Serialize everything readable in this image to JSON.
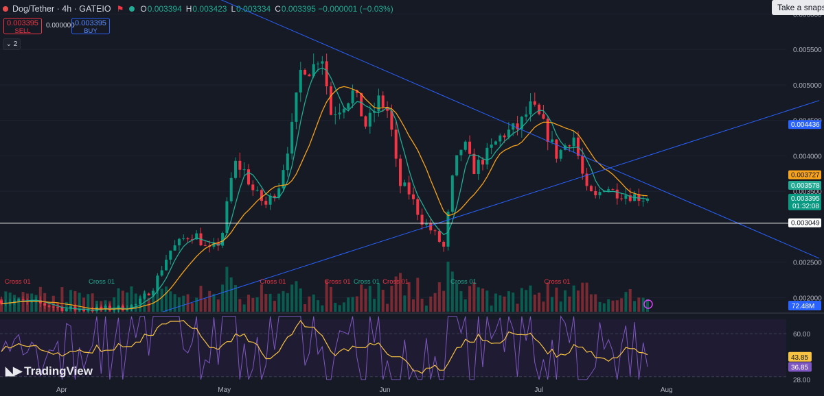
{
  "header": {
    "symbol": "Dog/Tether · 4h · GATEIO",
    "flag_icon": "flag-icon",
    "ohlc": [
      {
        "label": "O",
        "value": "0.003394"
      },
      {
        "label": "H",
        "value": "0.003423"
      },
      {
        "label": "L",
        "value": "0.003334"
      },
      {
        "label": "C",
        "value": "0.003395 −0.000001 (−0.03%)"
      }
    ]
  },
  "trade": {
    "sell_price": "0.003395",
    "sell_label": "SELL",
    "spread": "0.000000",
    "buy_price": "0.003395",
    "buy_label": "BUY"
  },
  "indicator_toggle": "2",
  "snapshot_tooltip": "Take a snapshot",
  "logo_text": "TradingView",
  "colors": {
    "background": "#161a25",
    "up": "#089981",
    "down": "#f23645",
    "ma_fast": "#22ab94",
    "ma_slow": "#f7a21b",
    "trendline": "#2962ff",
    "rsi": "#7e57c2",
    "rsi_ma": "#f7c343"
  },
  "chart_data": [
    {
      "type": "candlestick",
      "title": "Dog/Tether · 4h · GATEIO",
      "x_axis": {
        "tick_labels": [
          "Apr",
          "May",
          "Jun",
          "Jul",
          "Aug"
        ]
      },
      "y_axis": {
        "range": [
          0.0018,
          0.0061
        ],
        "tick_labels": [
          "0.006000",
          "0.005500",
          "0.005000",
          "0.004500",
          "0.004000",
          "0.003500",
          "0.002500",
          "0.002000"
        ],
        "tick_values": [
          0.006,
          0.0055,
          0.005,
          0.0045,
          0.004,
          0.0035,
          0.0025,
          0.002
        ]
      },
      "price_anchors": [
        {
          "t": 0.0,
          "p": 0.00196
        },
        {
          "t": 0.05,
          "p": 0.00193
        },
        {
          "t": 0.1,
          "p": 0.00184
        },
        {
          "t": 0.13,
          "p": 0.00183
        },
        {
          "t": 0.18,
          "p": 0.00185
        },
        {
          "t": 0.21,
          "p": 0.0019
        },
        {
          "t": 0.235,
          "p": 0.00215
        },
        {
          "t": 0.26,
          "p": 0.00265
        },
        {
          "t": 0.285,
          "p": 0.00285
        },
        {
          "t": 0.3,
          "p": 0.0029
        },
        {
          "t": 0.32,
          "p": 0.00265
        },
        {
          "t": 0.34,
          "p": 0.0028
        },
        {
          "t": 0.36,
          "p": 0.0039
        },
        {
          "t": 0.375,
          "p": 0.0038
        },
        {
          "t": 0.39,
          "p": 0.0035
        },
        {
          "t": 0.41,
          "p": 0.0033
        },
        {
          "t": 0.43,
          "p": 0.0036
        },
        {
          "t": 0.45,
          "p": 0.0044
        },
        {
          "t": 0.465,
          "p": 0.0053
        },
        {
          "t": 0.48,
          "p": 0.0052
        },
        {
          "t": 0.495,
          "p": 0.0055
        },
        {
          "t": 0.51,
          "p": 0.0046
        },
        {
          "t": 0.525,
          "p": 0.0047
        },
        {
          "t": 0.545,
          "p": 0.0049
        },
        {
          "t": 0.565,
          "p": 0.0044
        },
        {
          "t": 0.585,
          "p": 0.0048
        },
        {
          "t": 0.6,
          "p": 0.0046
        },
        {
          "t": 0.615,
          "p": 0.0036
        },
        {
          "t": 0.63,
          "p": 0.0035
        },
        {
          "t": 0.65,
          "p": 0.0031
        },
        {
          "t": 0.67,
          "p": 0.0029
        },
        {
          "t": 0.685,
          "p": 0.0027
        },
        {
          "t": 0.7,
          "p": 0.0038
        },
        {
          "t": 0.715,
          "p": 0.0042
        },
        {
          "t": 0.73,
          "p": 0.0038
        },
        {
          "t": 0.75,
          "p": 0.004
        },
        {
          "t": 0.775,
          "p": 0.0043
        },
        {
          "t": 0.8,
          "p": 0.0044
        },
        {
          "t": 0.82,
          "p": 0.0047
        },
        {
          "t": 0.835,
          "p": 0.0045
        },
        {
          "t": 0.86,
          "p": 0.004
        },
        {
          "t": 0.885,
          "p": 0.0043
        },
        {
          "t": 0.905,
          "p": 0.0035
        },
        {
          "t": 0.92,
          "p": 0.0034
        },
        {
          "t": 0.935,
          "p": 0.0036
        },
        {
          "t": 0.945,
          "p": 0.0035
        },
        {
          "t": 1.0,
          "p": 0.003395
        }
      ],
      "candle_count": 150,
      "moving_averages": [
        {
          "name": "MA fast",
          "period": 5,
          "color": "#22ab94"
        },
        {
          "name": "MA slow",
          "period": 12,
          "color": "#f7a21b"
        }
      ],
      "trendlines": [
        {
          "from": {
            "t": 0.34,
            "p": 0.0062
          },
          "to": {
            "t": 1.0,
            "p": 0.0036
          }
        },
        {
          "from": {
            "t": 0.25,
            "p": 0.0018
          },
          "to": {
            "t": 1.0,
            "p": 0.004
          }
        }
      ],
      "horizontal_line": 0.003049,
      "price_labels": [
        {
          "value": "0.004436",
          "price": 0.004436,
          "bg": "#2962ff",
          "fg": "#ffffff"
        },
        {
          "value": "0.003727",
          "price": 0.003727,
          "bg": "#f7a21b",
          "fg": "#131722"
        },
        {
          "value": "0.003578",
          "price": 0.003578,
          "bg": "#22ab94",
          "fg": "#ffffff"
        },
        {
          "value": "0.003395",
          "price": 0.003395,
          "bg": "#089981",
          "fg": "#ffffff",
          "sub": "01:32:08"
        },
        {
          "value": "0.003049",
          "price": 0.003049,
          "bg": "#ffffff",
          "fg": "#131722"
        }
      ],
      "cross_labels": [
        {
          "text": "Cross 01",
          "t": 0.005,
          "color": "#f23645"
        },
        {
          "text": "Cross 01",
          "t": 0.135,
          "color": "#22ab94"
        },
        {
          "text": "Cross 01",
          "t": 0.4,
          "color": "#f23645"
        },
        {
          "text": "Cross 01",
          "t": 0.5,
          "color": "#f23645"
        },
        {
          "text": "Cross 01",
          "t": 0.545,
          "color": "#22ab94"
        },
        {
          "text": "Cross 01",
          "t": 0.59,
          "color": "#f23645"
        },
        {
          "text": "Cross 01",
          "t": 0.695,
          "color": "#22ab94"
        },
        {
          "text": "Cross 01",
          "t": 0.84,
          "color": "#f23645"
        }
      ],
      "volume_label": "72.48M"
    },
    {
      "type": "line",
      "title": "RSI",
      "y_axis": {
        "range": [
          28,
          70
        ],
        "tick_labels": [
          "60.00",
          "28.00"
        ],
        "tick_values": [
          60,
          28
        ]
      },
      "series": [
        {
          "name": "RSI",
          "last": 36.85,
          "last_label": "36.85",
          "color": "#7e57c2"
        },
        {
          "name": "RSI MA",
          "last": 43.85,
          "last_label": "43.85",
          "color": "#f7c343"
        }
      ],
      "x_axis": {
        "tick_labels": [
          "Apr",
          "May",
          "Jun",
          "Jul",
          "Aug"
        ]
      }
    }
  ]
}
